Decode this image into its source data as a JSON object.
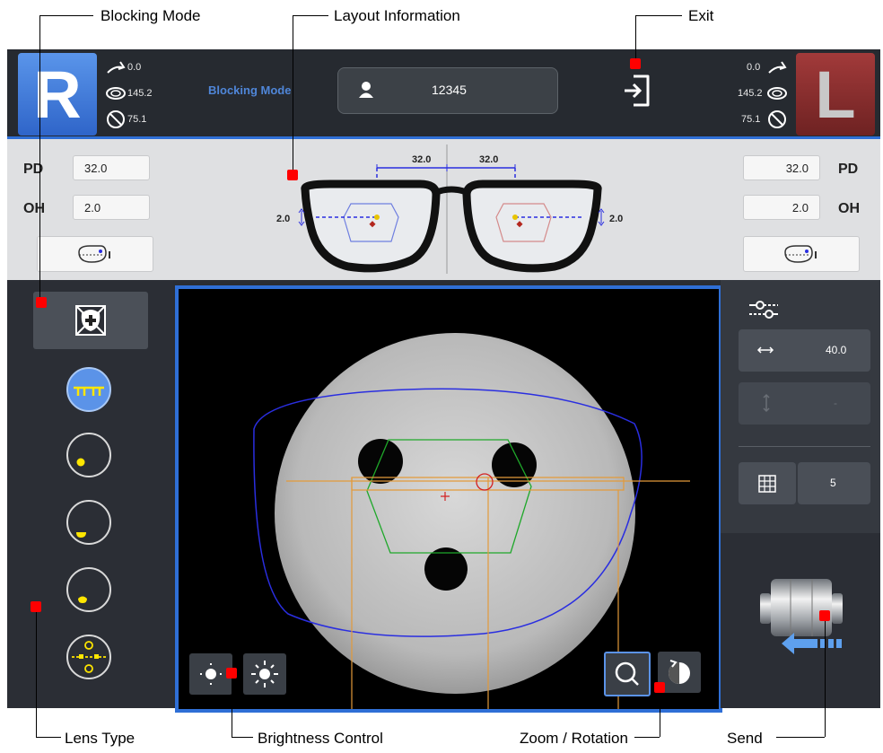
{
  "callouts": {
    "blocking_mode": "Blocking Mode",
    "layout_information": "Layout Information",
    "exit": "Exit",
    "lens_type": "Lens Type",
    "brightness_control": "Brightness Control",
    "zoom_rotation": "Zoom / Rotation",
    "send": "Send"
  },
  "header": {
    "right_eye_label": "R",
    "left_eye_label": "L",
    "right_values": {
      "cylinder": "0.0",
      "axis": "145.2",
      "prism": "75.1"
    },
    "left_values": {
      "cylinder": "0.0",
      "axis": "145.2",
      "prism": "75.1"
    },
    "mode_label": "Blocking Mode",
    "patient_id": "12345",
    "icons": [
      "user-icon",
      "exit-icon"
    ]
  },
  "layout_info": {
    "right": {
      "pd_label": "PD",
      "pd_value": "32.0",
      "oh_label": "OH",
      "oh_value": "2.0"
    },
    "left": {
      "pd_label": "PD",
      "pd_value": "32.0",
      "oh_label": "OH",
      "oh_value": "2.0"
    },
    "diagram": {
      "right_pd": "32.0",
      "left_pd": "32.0",
      "right_oh": "2.0",
      "left_oh": "2.0"
    }
  },
  "right_panel": {
    "size_value": "40.0",
    "vertical_value": "-",
    "grid_value": "5"
  },
  "colors": {
    "accent": "#2f6fd6",
    "right_eye": "#3a78d8",
    "left_eye": "#8b2b2b",
    "marker": "#ff0000",
    "lens_yellow": "#ffe600",
    "frame_blue": "#2a2ee0",
    "lens_green": "#1fa82a",
    "orange": "#e39a3a"
  }
}
